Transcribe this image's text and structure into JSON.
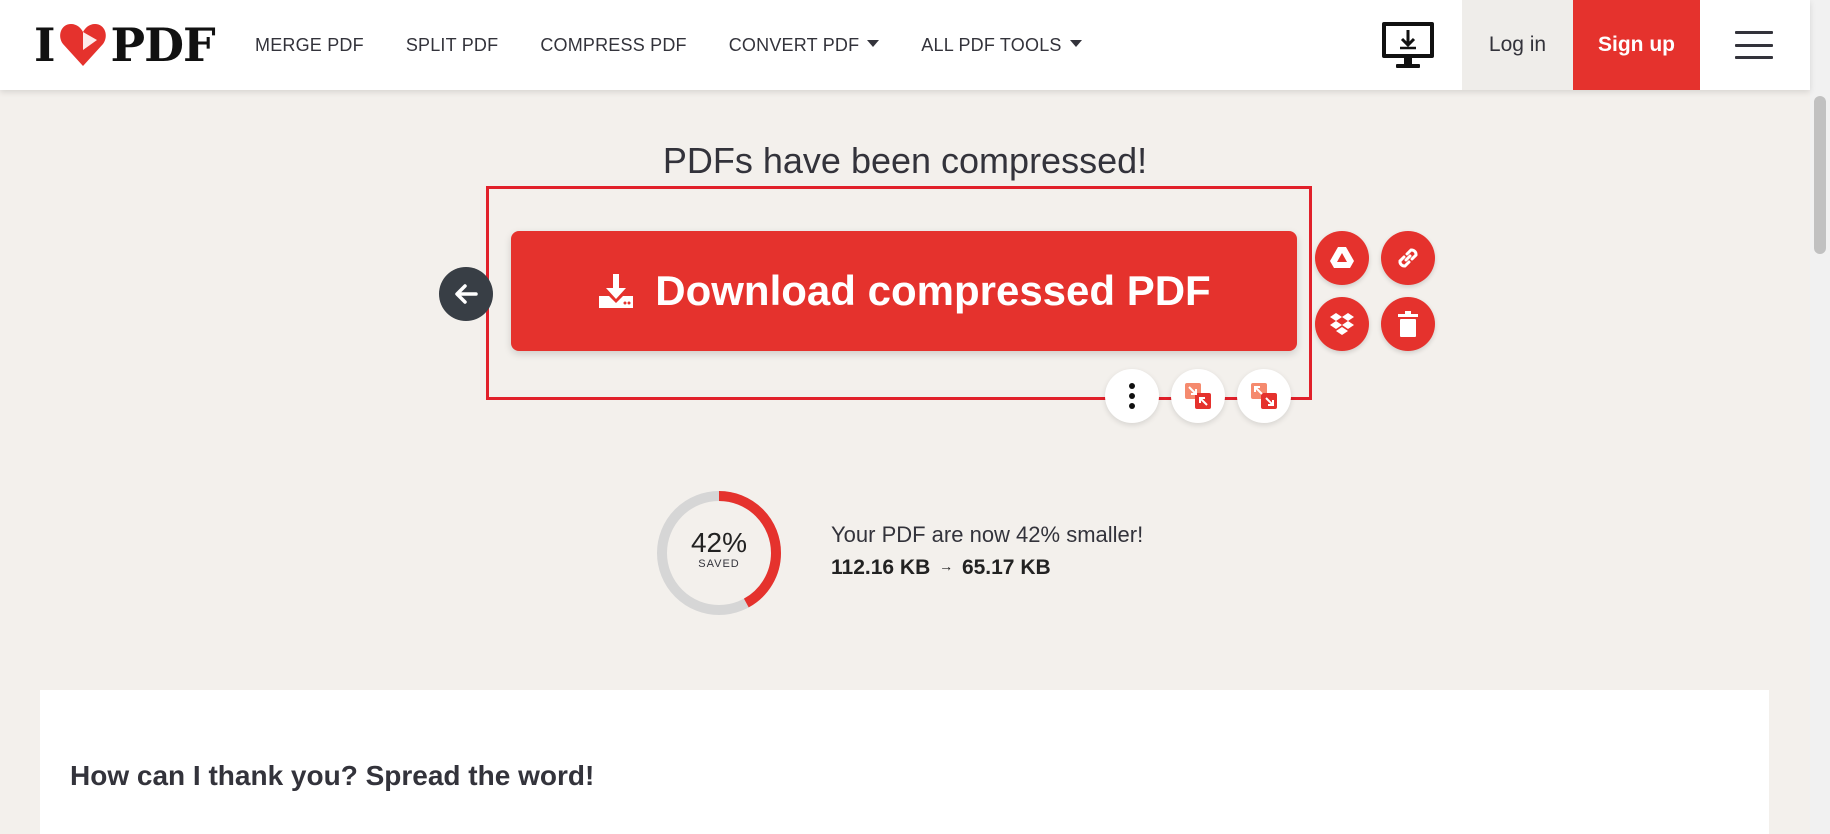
{
  "header": {
    "logo_text": "I PDF",
    "logo_left": "I",
    "logo_right": "PDF",
    "nav": [
      {
        "label": "MERGE PDF",
        "has_dropdown": false
      },
      {
        "label": "SPLIT PDF",
        "has_dropdown": false
      },
      {
        "label": "COMPRESS PDF",
        "has_dropdown": false
      },
      {
        "label": "CONVERT PDF",
        "has_dropdown": true
      },
      {
        "label": "ALL PDF TOOLS",
        "has_dropdown": true
      }
    ],
    "desktop_icon": "desktop-download-icon",
    "login_label": "Log in",
    "signup_label": "Sign up",
    "menu_icon": "hamburger-icon"
  },
  "main": {
    "title": "PDFs have been compressed!",
    "download_label": "Download compressed PDF",
    "download_icon": "download-icon",
    "back_icon": "arrow-left-icon",
    "side_actions": [
      "google-drive-icon",
      "link-icon",
      "dropbox-icon",
      "trash-icon"
    ],
    "bottom_actions": [
      "more-vertical-icon",
      "compress-arrows-icon",
      "expand-arrows-icon"
    ]
  },
  "savings": {
    "percent_value": 42,
    "percent_label": "42%",
    "saved_label": "SAVED",
    "message": "Your PDF are now 42% smaller!",
    "original_size": "112.16 KB",
    "new_size": "65.17 KB",
    "arrow": "→"
  },
  "panel": {
    "title": "How can I thank you? Spread the word!"
  },
  "colors": {
    "brand_red": "#e5322d",
    "dark": "#383e45",
    "background": "#f3f0ec",
    "ring_track": "#d6d6d6"
  }
}
